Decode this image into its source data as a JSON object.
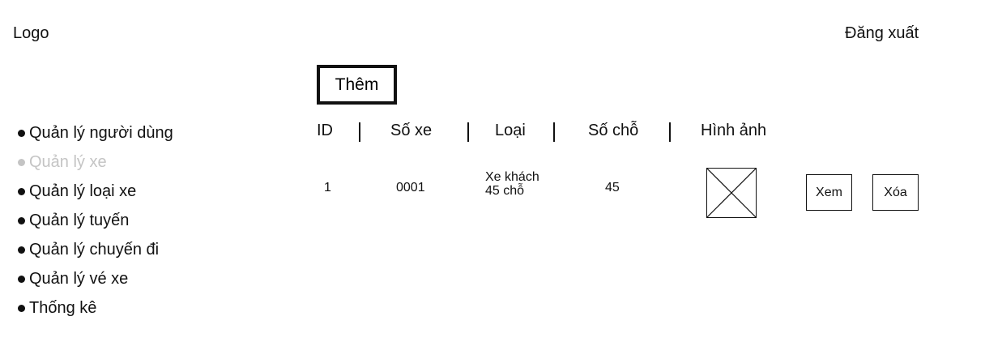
{
  "header": {
    "logo": "Logo",
    "logout": "Đăng xuất"
  },
  "toolbar": {
    "add_label": "Thêm"
  },
  "sidebar": {
    "items": [
      {
        "label": "Quản lý người dùng",
        "state": "normal"
      },
      {
        "label": "Quản lý xe",
        "state": "muted"
      },
      {
        "label": "Quản lý loại xe",
        "state": "normal"
      },
      {
        "label": "Quản lý tuyến",
        "state": "normal"
      },
      {
        "label": "Quản lý chuyến đi",
        "state": "normal"
      },
      {
        "label": "Quản lý vé xe",
        "state": "normal"
      },
      {
        "label": "Thống kê",
        "state": "normal"
      }
    ]
  },
  "table": {
    "columns": [
      "ID",
      "Số xe",
      "Loại",
      "Số chỗ",
      "Hình ảnh"
    ],
    "rows": [
      {
        "id": "1",
        "plate": "0001",
        "type_line1": "Xe khách",
        "type_line2": "45 chỗ",
        "seats": "45",
        "image": "image-placeholder-icon",
        "view_label": "Xem",
        "delete_label": "Xóa"
      }
    ]
  },
  "colors": {
    "text": "#111111",
    "muted": "#c4c4c4",
    "background": "#ffffff"
  }
}
